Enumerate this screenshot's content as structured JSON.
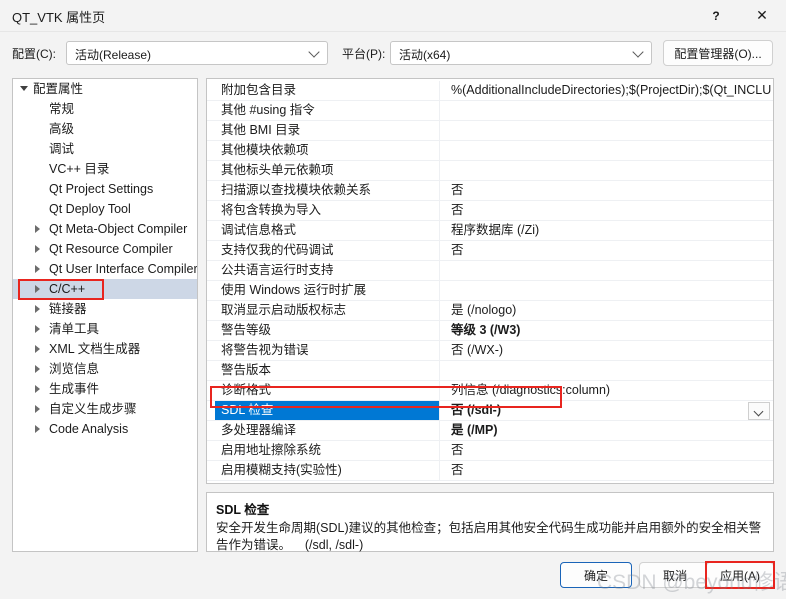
{
  "window": {
    "title": "QT_VTK 属性页",
    "help_label": "?",
    "close_label": "✕"
  },
  "config_bar": {
    "config_label": "配置(C):",
    "config_value": "活动(Release)",
    "platform_label": "平台(P):",
    "platform_value": "活动(x64)",
    "config_manager_button": "配置管理器(O)..."
  },
  "tree": {
    "items": [
      {
        "label": "配置属性",
        "depth": 0,
        "arrow": "expanded",
        "selected": false
      },
      {
        "label": "常规",
        "depth": 1,
        "arrow": "none",
        "selected": false
      },
      {
        "label": "高级",
        "depth": 1,
        "arrow": "none",
        "selected": false
      },
      {
        "label": "调试",
        "depth": 1,
        "arrow": "none",
        "selected": false
      },
      {
        "label": "VC++ 目录",
        "depth": 1,
        "arrow": "none",
        "selected": false
      },
      {
        "label": "Qt Project Settings",
        "depth": 1,
        "arrow": "none",
        "selected": false
      },
      {
        "label": "Qt Deploy Tool",
        "depth": 1,
        "arrow": "none",
        "selected": false
      },
      {
        "label": "Qt Meta-Object Compiler",
        "depth": 1,
        "arrow": "collapsed",
        "selected": false
      },
      {
        "label": "Qt Resource Compiler",
        "depth": 1,
        "arrow": "collapsed",
        "selected": false
      },
      {
        "label": "Qt User Interface Compiler",
        "depth": 1,
        "arrow": "collapsed",
        "selected": false
      },
      {
        "label": "C/C++",
        "depth": 1,
        "arrow": "collapsed",
        "selected": true
      },
      {
        "label": "链接器",
        "depth": 1,
        "arrow": "collapsed",
        "selected": false
      },
      {
        "label": "清单工具",
        "depth": 1,
        "arrow": "collapsed",
        "selected": false
      },
      {
        "label": "XML 文档生成器",
        "depth": 1,
        "arrow": "collapsed",
        "selected": false
      },
      {
        "label": "浏览信息",
        "depth": 1,
        "arrow": "collapsed",
        "selected": false
      },
      {
        "label": "生成事件",
        "depth": 1,
        "arrow": "collapsed",
        "selected": false
      },
      {
        "label": "自定义生成步骤",
        "depth": 1,
        "arrow": "collapsed",
        "selected": false
      },
      {
        "label": "Code Analysis",
        "depth": 1,
        "arrow": "collapsed",
        "selected": false
      }
    ]
  },
  "grid": {
    "rows": [
      {
        "name": "附加包含目录",
        "value": "%(AdditionalIncludeDirectories);$(ProjectDir);$(Qt_INCLUDE",
        "bold": false,
        "selected": false
      },
      {
        "name": "其他 #using 指令",
        "value": "",
        "bold": false,
        "selected": false
      },
      {
        "name": "其他 BMI 目录",
        "value": "",
        "bold": false,
        "selected": false
      },
      {
        "name": "其他模块依赖项",
        "value": "",
        "bold": false,
        "selected": false
      },
      {
        "name": "其他标头单元依赖项",
        "value": "",
        "bold": false,
        "selected": false
      },
      {
        "name": "扫描源以查找模块依赖关系",
        "value": "否",
        "bold": false,
        "selected": false
      },
      {
        "name": "将包含转换为导入",
        "value": "否",
        "bold": false,
        "selected": false
      },
      {
        "name": "调试信息格式",
        "value": "程序数据库 (/Zi)",
        "bold": false,
        "selected": false
      },
      {
        "name": "支持仅我的代码调试",
        "value": "否",
        "bold": false,
        "selected": false
      },
      {
        "name": "公共语言运行时支持",
        "value": "",
        "bold": false,
        "selected": false
      },
      {
        "name": "使用 Windows 运行时扩展",
        "value": "",
        "bold": false,
        "selected": false
      },
      {
        "name": "取消显示启动版权标志",
        "value": "是 (/nologo)",
        "bold": false,
        "selected": false
      },
      {
        "name": "警告等级",
        "value": "等级 3 (/W3)",
        "bold": true,
        "selected": false
      },
      {
        "name": "将警告视为错误",
        "value": "否 (/WX-)",
        "bold": false,
        "selected": false
      },
      {
        "name": "警告版本",
        "value": "",
        "bold": false,
        "selected": false
      },
      {
        "name": "诊断格式",
        "value": "列信息 (/diagnostics:column)",
        "bold": false,
        "selected": false
      },
      {
        "name": "SDL 检查",
        "value": "否 (/sdl-)",
        "bold": true,
        "selected": true
      },
      {
        "name": "多处理器编译",
        "value": "是 (/MP)",
        "bold": true,
        "selected": false
      },
      {
        "name": "启用地址擦除系统",
        "value": "否",
        "bold": false,
        "selected": false
      },
      {
        "name": "启用模糊支持(实验性)",
        "value": "否",
        "bold": false,
        "selected": false
      }
    ]
  },
  "description": {
    "title": "SDL 检查",
    "body": "安全开发生命周期(SDL)建议的其他检查；包括启用其他安全代码生成功能并启用额外的安全相关警告作为错误。    (/sdl, /sdl-)"
  },
  "footer": {
    "ok_label": "确定",
    "cancel_label": "取消",
    "apply_label": "应用(A)"
  },
  "watermark": {
    "text": "CSDN @beyond修语"
  },
  "colors": {
    "selection_blue": "#0078d4",
    "tree_selection": "#cdd7e6",
    "annotation_red": "#e8251f",
    "dialog_bg": "#f3f3f3"
  }
}
